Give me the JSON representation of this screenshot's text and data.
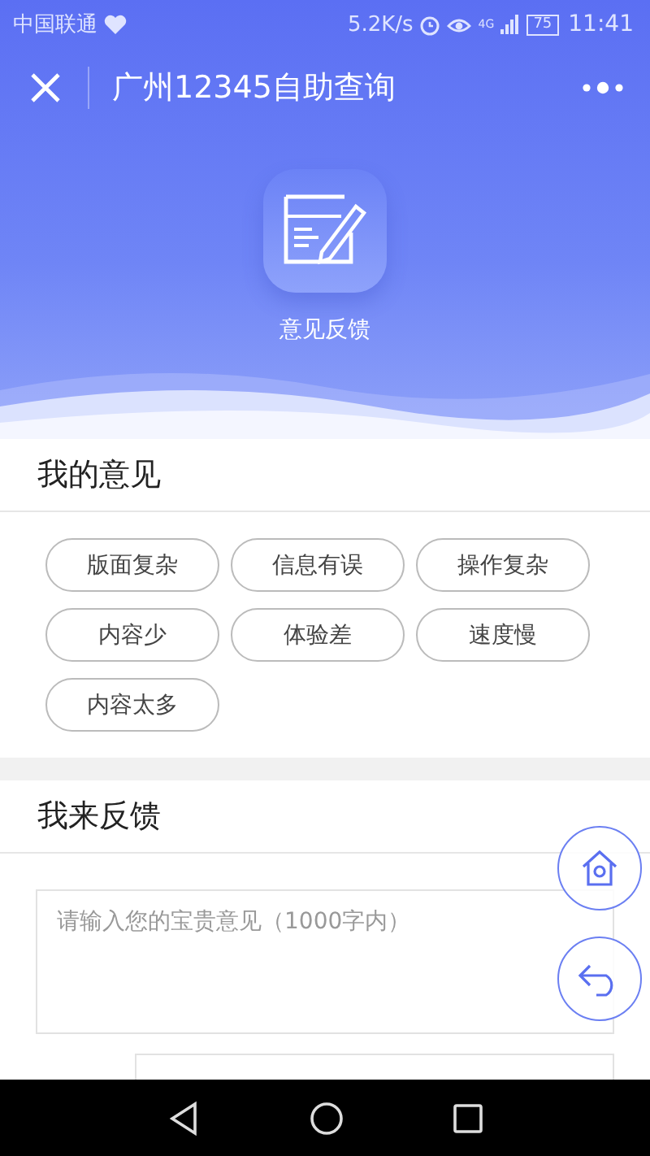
{
  "status_bar": {
    "carrier": "中国联通",
    "speed": "5.2K/s",
    "network": "4G",
    "battery": "75",
    "time": "11:41"
  },
  "nav": {
    "title": "广州12345自助查询"
  },
  "header": {
    "label": "意见反馈"
  },
  "opinion_section": {
    "title": "我的意见",
    "tags": [
      "版面复杂",
      "信息有误",
      "操作复杂",
      "内容少",
      "体验差",
      "速度慢",
      "内容太多"
    ]
  },
  "feedback_section": {
    "title": "我来反馈",
    "textarea": {
      "placeholder": "请输入您的宝贵意见（1000字内）"
    }
  }
}
